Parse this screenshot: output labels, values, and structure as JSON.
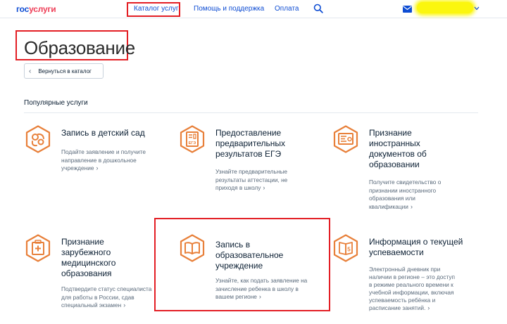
{
  "header": {
    "logo_part1": "гос",
    "logo_part2": "услуги",
    "nav": {
      "catalog": "Каталог услуг",
      "help": "Помощь и поддержка",
      "payment": "Оплата"
    }
  },
  "colors": {
    "brand_blue": "#0d4cd3",
    "brand_red": "#ee3f58",
    "icon_orange": "#e8803a",
    "annotation_red": "#e31e24",
    "highlight_yellow": "#fbf60e"
  },
  "page": {
    "title": "Образование",
    "back_button": "Вернуться в каталог",
    "section_title": "Популярные услуги"
  },
  "services": [
    {
      "icon": "pacifier-icon",
      "title": "Запись в детский сад",
      "description": "Подайте заявление и получите направление в дошкольное учреждение"
    },
    {
      "icon": "exam-document-icon",
      "icon_label": "ЕГЭ",
      "title": "Предоставление предварительных результатов ЕГЭ",
      "description": "Узнайте предварительные результаты аттестации, не приходя в школу"
    },
    {
      "icon": "foreign-diploma-icon",
      "title": "Признание иностранных документов об образовании",
      "description": "Получите свидетельство о признании иностранного образования или квалификации"
    },
    {
      "icon": "medical-document-icon",
      "title": "Признание зарубежного медицинского образования",
      "description": "Подтвердите статус специалиста для работы в России, сдав специальный экзамен"
    },
    {
      "icon": "open-book-icon",
      "title": "Запись в образовательное учреждение",
      "description": "Узнайте, как подать заявление на зачисление ребенка в школу в вашем регионе"
    },
    {
      "icon": "diary-icon",
      "title": "Информация о текущей успеваемости",
      "description": "Электронный дневник при наличии в регионе – это доступ в режиме реального времени к учебной информации, включая успеваемость ребёнка и расписание занятий."
    }
  ],
  "arrow_glyph": "›"
}
